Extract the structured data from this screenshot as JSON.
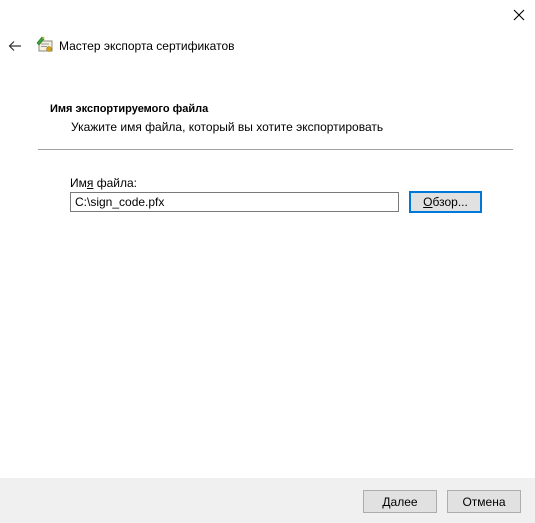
{
  "window": {
    "close_icon": "close-icon",
    "back_icon": "back-arrow-icon",
    "wizard_icon": "certificate-wizard-icon",
    "title": "Мастер экспорта сертификатов"
  },
  "section": {
    "heading": "Имя экспортируемого файла",
    "description": "Укажите имя файла, который вы хотите экспортировать"
  },
  "form": {
    "file_label_pre": "Им",
    "file_label_accel": "я",
    "file_label_post": " файла:",
    "file_value": "C:\\sign_code.pfx",
    "browse_accel": "О",
    "browse_rest": "бзор..."
  },
  "footer": {
    "next_accel": "Д",
    "next_rest": "алее",
    "cancel_label": "Отмена"
  },
  "colors": {
    "focus_border": "#0078d7",
    "footer_bg": "#f0f0f0",
    "button_bg": "#e1e1e1"
  }
}
